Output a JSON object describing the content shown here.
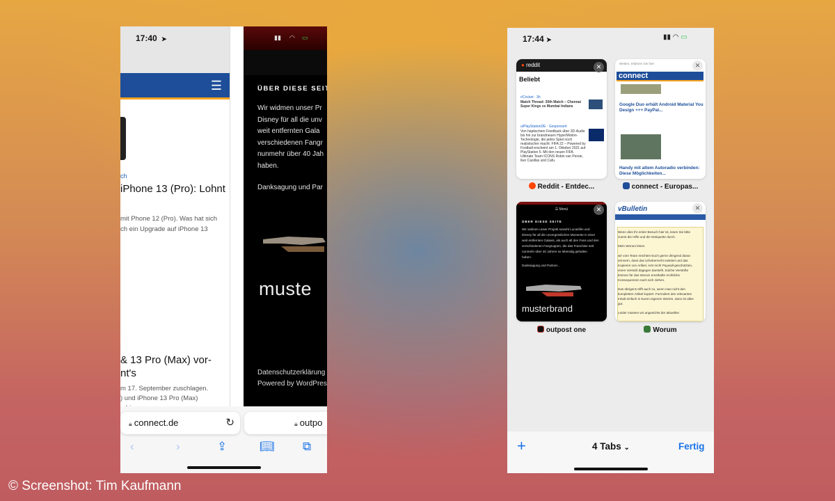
{
  "left_phone": {
    "status_time": "17:40",
    "card1": {
      "kicker": "ch",
      "headline_1": "iPhone 13 (Pro): Lohnt",
      "body_1": [
        "mit Phone 12 (Pro). Was hat sich",
        "ch ein Upgrade auf iPhone 13"
      ],
      "headline_2": [
        "& 13 Pro (Max) vor-",
        "nt's"
      ],
      "body_2": [
        "m 17. September zuschlagen.",
        ") und iPhone 13 Pro (Max)",
        "n hier"
      ]
    },
    "card2": {
      "title": "ÜBER DIESE SEIT",
      "body": [
        "Wir widmen unser Pr",
        "Disney für all die unv",
        "weit entfernten Gala",
        "verschiedenen Fangr",
        "nunmehr über 40 Jah",
        "haben."
      ],
      "thanks": "Danksagung und Par",
      "brand": "muste",
      "footer_1": "Datenschutzerklärung",
      "footer_2": "Powered by WordPres"
    },
    "url_1": "connect.de",
    "url_2": "outpo",
    "icons": [
      "back-icon",
      "forward-icon",
      "share-icon",
      "bookmarks-icon",
      "tabs-icon"
    ]
  },
  "right_phone": {
    "status_time": "17:44",
    "tabs": [
      {
        "title": "Reddit - Entdec...",
        "brand": "reddit",
        "heading": "Beliebt",
        "lines": [
          "r/Cricket · 3h",
          "Match Thread: 30th Match – Chennai",
          "Super Kings vs Mumbai Indians"
        ],
        "lines_b": [
          "u/PlayStationDE · Gesponsert",
          "Von haptischem Feedback über 3D-Audio",
          "bis hin zur brandneuen HyperMotion-",
          "Technologie, die jedes Spiel noch",
          "realistischer macht: FIFA 22 – Powered by",
          "Football erscheint am 1. Oktober 2021 auf",
          "PlayStation 5. Mit den neuen FIFA",
          "Ultimate Team ICONS Robin van Persie,",
          "Iker Casillas und Cafu."
        ]
      },
      {
        "title": "connect - Europas...",
        "brand": "connect",
        "toplink": "Wetten, erfahren Sie hier",
        "heading_1": [
          "Google Duo erhält Android Material You",
          "Design +++ PayPal..."
        ],
        "heading_2": [
          "Handy mit altem Autoradio verbinden:",
          "Diese Möglichkeiten..."
        ]
      },
      {
        "title": "outpost one",
        "menu": "☰ Menü",
        "heading": "ÜBER DIESE SEITE",
        "lines": [
          "Wir widmen unser Projekt sowohl Lucasfilm und",
          "Disney für all die unvergesslichen Momente in einer",
          "weit entfernten Galaxis, als auch all den Fans und den",
          "verschiedenen Fangruppen, die das Franchise seit",
          "nunmehr über 40 Jahren so lebendig gehalten",
          "haben."
        ],
        "thanks": "Danksagung und Partner...",
        "brand": "musterbrand"
      },
      {
        "title": "Worum",
        "brand": "vBulletin",
        "lines": [
          "Wenn dies Ihr erster Besuch hier ist, lesen Sie bitte",
          "zuerst die Hilfe und die Netiquette durch.",
          "",
          "Mein Worum lösen.",
          "",
          "wir vom Team möchten Euch gerne dringend daran",
          "erinnern, dass das Urheberrecht existiert und das",
          "Kopieren von Artikel, erst recht Paywall-geschützten,",
          "einen Verstoß dagegen darstellt. Solche Verstöße",
          "können für das Worum ernsthafte rechtliche",
          "Konsequenzen nach sich ziehen.",
          "",
          "Das übrigens trifft auch zu, wenn man nicht den",
          "kompletten Artikel kopiert. Formuliert den relevanten",
          "Inhalt einfach in Euren eigenen Worten, dann ist alles",
          "gut.",
          "",
          "Leider müssen wir angesichts der aktuellen"
        ]
      }
    ],
    "tab_count": "4 Tabs",
    "done": "Fertig"
  },
  "credit": "© Screenshot: Tim Kaufmann",
  "colors": {
    "accent": "#1a73e8",
    "connect_blue": "#1e4e9a",
    "connect_orange": "#f3a21f"
  }
}
